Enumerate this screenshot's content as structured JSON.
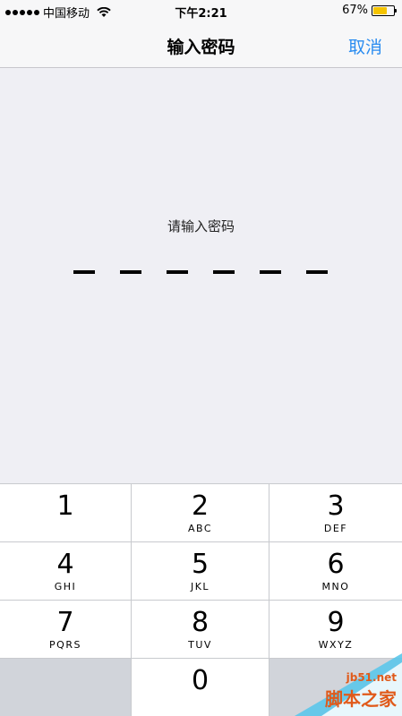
{
  "status_bar": {
    "carrier": "中国移动",
    "time": "下午2:21",
    "battery_percent": "67%",
    "battery_level": 0.67
  },
  "nav": {
    "title": "输入密码",
    "cancel_label": "取消"
  },
  "prompt": "请输入密码",
  "passcode_length": 6,
  "keypad": {
    "keys": [
      {
        "num": "1",
        "letters": ""
      },
      {
        "num": "2",
        "letters": "ABC"
      },
      {
        "num": "3",
        "letters": "DEF"
      },
      {
        "num": "4",
        "letters": "GHI"
      },
      {
        "num": "5",
        "letters": "JKL"
      },
      {
        "num": "6",
        "letters": "MNO"
      },
      {
        "num": "7",
        "letters": "PQRS"
      },
      {
        "num": "8",
        "letters": "TUV"
      },
      {
        "num": "9",
        "letters": "WXYZ"
      },
      {
        "num": "0",
        "letters": ""
      }
    ]
  },
  "watermark": {
    "site": "jb51.net",
    "name": "脚本之家"
  },
  "colors": {
    "accent": "#2a8cf0",
    "battery": "#f5c400"
  }
}
